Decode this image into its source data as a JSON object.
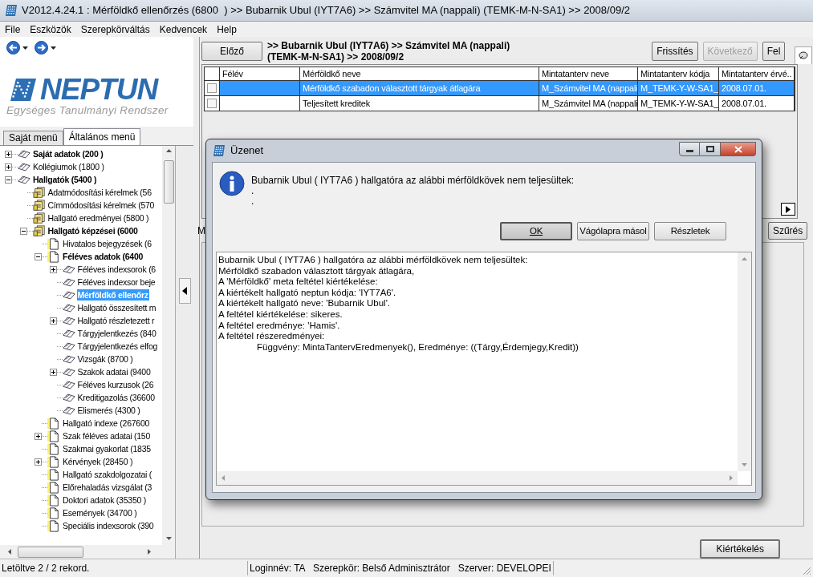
{
  "window": {
    "title": "V2012.4.24.1 : Mérföldkő ellenőrzés (6800  ) >> Bubarnik Ubul (IYT7A6) >> Számvitel MA (nappali) (TEMK-M-N-SA1) >> 2008/09/2"
  },
  "menu": [
    "File",
    "Eszközök",
    "Szerepkörváltás",
    "Kedvencek",
    "Help"
  ],
  "logo": {
    "name": "NEPTUN",
    "subtitle": "Egységes Tanulmányi Rendszer"
  },
  "sidebar_tabs": [
    {
      "label": "Saját menü",
      "selected": false
    },
    {
      "label": "Általános menü",
      "selected": true
    }
  ],
  "tree": [
    {
      "label": "Saját adatok (200 )",
      "kind": "book",
      "bold": true,
      "selected": false,
      "expanded": false
    },
    {
      "label": "Kollégiumok (1800 )",
      "kind": "book",
      "bold": false,
      "selected": false,
      "expanded": false
    },
    {
      "label": "Hallgatók (5400 )",
      "kind": "book",
      "bold": true,
      "selected": false,
      "expanded": true,
      "children": [
        {
          "label": "Adatmódosítási kérelmek (56",
          "kind": "docs",
          "bold": false,
          "selected": false
        },
        {
          "label": "Címmódosítási kérelmek (570",
          "kind": "docs",
          "bold": false,
          "selected": false
        },
        {
          "label": "Hallgató eredményei (5800 )",
          "kind": "docs",
          "bold": false,
          "selected": false
        },
        {
          "label": "Hallgató képzései (6000",
          "kind": "docs",
          "bold": true,
          "selected": false,
          "expanded": true,
          "children": [
            {
              "label": "Hivatalos bejegyzések (6",
              "kind": "page",
              "bold": false,
              "selected": false
            },
            {
              "label": "Féléves adatok (6400",
              "kind": "page",
              "bold": true,
              "selected": false,
              "expanded": true,
              "children": [
                {
                  "label": "Féléves indexsorok (6",
                  "kind": "book",
                  "bold": false,
                  "selected": false,
                  "expanded": false
                },
                {
                  "label": "Féléves indexsor beje",
                  "kind": "book",
                  "bold": false,
                  "selected": false
                },
                {
                  "label": "Mérföldkő ellenőrz",
                  "kind": "book",
                  "bold": true,
                  "selected": true
                },
                {
                  "label": "Hallgató összesített m",
                  "kind": "book",
                  "bold": false,
                  "selected": false
                },
                {
                  "label": "Hallgató részletezett r",
                  "kind": "book",
                  "bold": false,
                  "selected": false,
                  "expanded": false
                },
                {
                  "label": "Tárgyjelentkezés (840",
                  "kind": "book",
                  "bold": false,
                  "selected": false
                },
                {
                  "label": "Tárgyjelentkezés elfog",
                  "kind": "book",
                  "bold": false,
                  "selected": false
                },
                {
                  "label": "Vizsgák (8700 )",
                  "kind": "book",
                  "bold": false,
                  "selected": false
                },
                {
                  "label": "Szakok adatai (9400",
                  "kind": "book",
                  "bold": false,
                  "selected": false,
                  "expanded": false
                },
                {
                  "label": "Féléves kurzusok (26",
                  "kind": "book",
                  "bold": false,
                  "selected": false
                },
                {
                  "label": "Kreditigazolás (36600",
                  "kind": "book",
                  "bold": false,
                  "selected": false
                },
                {
                  "label": "Elismerés (4300 )",
                  "kind": "book",
                  "bold": false,
                  "selected": false
                }
              ]
            },
            {
              "label": "Hallgató indexe (267600",
              "kind": "page",
              "bold": false,
              "selected": false
            },
            {
              "label": "Szak féléves adatai (150",
              "kind": "page",
              "bold": false,
              "selected": false,
              "expanded": false
            },
            {
              "label": "Szakmai gyakorlat (1835",
              "kind": "page",
              "bold": false,
              "selected": false
            },
            {
              "label": "Kérvények (28450 )",
              "kind": "page",
              "bold": false,
              "selected": false,
              "expanded": false
            },
            {
              "label": "Hallgató szakdolgozatai (",
              "kind": "page",
              "bold": false,
              "selected": false
            },
            {
              "label": "Előrehaladás vizsgálat (3",
              "kind": "page",
              "bold": false,
              "selected": false
            },
            {
              "label": "Doktori adatok (35350 )",
              "kind": "page",
              "bold": false,
              "selected": false
            },
            {
              "label": "Események (34700 )",
              "kind": "page",
              "bold": false,
              "selected": false
            },
            {
              "label": "Speciális indexsorok (390",
              "kind": "page",
              "bold": false,
              "selected": false
            }
          ]
        }
      ]
    }
  ],
  "toolbar": {
    "prev": "Előző",
    "breadcrumb": [
      ">> Bubarnik Ubul (IYT7A6) >> Számvitel MA (nappali)",
      "(TEMK-M-N-SA1) >> 2008/09/2"
    ],
    "buttons": [
      {
        "label": "Frissítés",
        "disabled": false
      },
      {
        "label": "Következő",
        "disabled": true
      },
      {
        "label": "Fel",
        "disabled": false
      }
    ]
  },
  "table": {
    "columns": [
      "Félév",
      "Mérföldkő neve",
      "Mintatanterv neve",
      "Mintatanterv kódja",
      "Mintatanterv érvé.."
    ],
    "rows": [
      {
        "checked": false,
        "selected": true,
        "cells": [
          null,
          "Mérföldkő szabadon választott tárgyak átlagára",
          "M_Számvitel MA (nappali",
          "M_TEMK-Y-W-SA1_",
          "2008.07.01."
        ]
      },
      {
        "checked": false,
        "selected": false,
        "cells": [
          null,
          "Teljesített kreditek",
          "M_Számvitel MA (nappali",
          "M_TEMK-Y-W-SA1_",
          "2008.07.01."
        ]
      }
    ]
  },
  "filter": {
    "label": "M",
    "button": "Szűrés"
  },
  "evaluate_button": "Kiértékelés",
  "dialog": {
    "title": "Üzenet",
    "message": "Bubarnik Ubul ( IYT7A6 ) hallgatóra az alábbi mérföldkövek nem teljesültek:",
    "message_lines": [
      ".",
      "."
    ],
    "buttons": [
      {
        "label": "OK",
        "default": true
      },
      {
        "label": "Vágólapra másol",
        "default": false
      },
      {
        "label": "Részletek",
        "default": false
      }
    ],
    "details": [
      {
        "text": "Bubarnik Ubul ( IYT7A6 ) hallgatóra az alábbi mérföldkövek nem teljesültek:",
        "indented": false
      },
      {
        "text": "Mérföldkő szabadon választott tárgyak átlagára,",
        "indented": false
      },
      {
        "text": "A 'Mérföldkő' meta feltétel kiértékelése:",
        "indented": false
      },
      {
        "text": "A kiértékelt hallgató neptun kódja: 'IYT7A6'.",
        "indented": false
      },
      {
        "text": "A kiértékelt hallgató neve: 'Bubarnik Ubul'.",
        "indented": false
      },
      {
        "text": "A feltétel kiértékelése: sikeres.",
        "indented": false
      },
      {
        "text": "A feltétel eredménye: 'Hamis'.",
        "indented": false
      },
      {
        "text": "A feltétel részeredményei:",
        "indented": false
      },
      {
        "text": "Függvény: MintaTantervEredmenyek(), Eredménye: ((Tárgy,Érdemjegy,Kredit))",
        "indented": true
      }
    ]
  },
  "status_bar": {
    "left": "Letöltve 2 / 2 rekord.",
    "info": "Loginnév: TA   Szerepkör: Belső Adminisztrátor   Szerver: DEVELOPEI"
  }
}
